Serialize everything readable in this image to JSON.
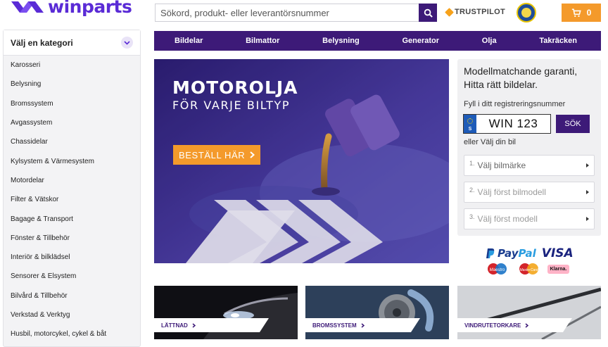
{
  "brand": {
    "name": "winparts",
    "color": "#5a2bd6"
  },
  "search": {
    "placeholder": "Sökord, produkt- eller leverantörsnummer",
    "value": ""
  },
  "trust": {
    "label": "TRUSTPILOT"
  },
  "cart": {
    "count": "0"
  },
  "sidebar": {
    "title": "Välj en kategori",
    "items": [
      {
        "label": "Karosseri"
      },
      {
        "label": "Belysning"
      },
      {
        "label": "Bromssystem"
      },
      {
        "label": "Avgassystem"
      },
      {
        "label": "Chassidelar"
      },
      {
        "label": "Kylsystem & Värmesystem"
      },
      {
        "label": "Motordelar"
      },
      {
        "label": "Filter & Vätskor"
      },
      {
        "label": "Bagage & Transport"
      },
      {
        "label": "Fönster & Tillbehör"
      },
      {
        "label": "Interiör & bilklädsel"
      },
      {
        "label": "Sensorer & Elsystem"
      },
      {
        "label": "Bilvård & Tillbehör"
      },
      {
        "label": "Verkstad & Verktyg"
      },
      {
        "label": "Husbil, motorcykel, cykel & båt"
      }
    ]
  },
  "nav": {
    "items": [
      {
        "label": "Bildelar"
      },
      {
        "label": "Bilmattor"
      },
      {
        "label": "Belysning"
      },
      {
        "label": "Generator"
      },
      {
        "label": "Olja"
      },
      {
        "label": "Takräcken"
      }
    ]
  },
  "hero": {
    "title": "MOTOROLJA",
    "subtitle": "FÖR VARJE BILTYP",
    "cta": "BESTÄLL HÄR"
  },
  "match": {
    "title": "Modellmatchande garanti, Hitta rätt bildelar.",
    "reg_label": "Fyll i ditt registreringsnummer",
    "plate_country": "S",
    "plate_value": "WIN 123",
    "search_button": "SÖK",
    "or_label": "eller Välj din bil",
    "selects": [
      {
        "num": "1.",
        "label": "Välj bilmärke"
      },
      {
        "num": "2.",
        "label": "Välj först bilmodell"
      },
      {
        "num": "3.",
        "label": "Välj först modell"
      }
    ]
  },
  "payments": {
    "paypal_a": "Pay",
    "paypal_b": "Pal",
    "visa": "VISA",
    "maestro": "Maestro",
    "mastercard": "MasterCard",
    "klarna": "Klarna."
  },
  "tiles": [
    {
      "label": "LÄTTNAD"
    },
    {
      "label": "BROMSSYSTEM"
    },
    {
      "label": "VINDRUTETORKARE"
    }
  ],
  "colors": {
    "primary": "#3d1a78",
    "accent": "#f49a2b"
  }
}
